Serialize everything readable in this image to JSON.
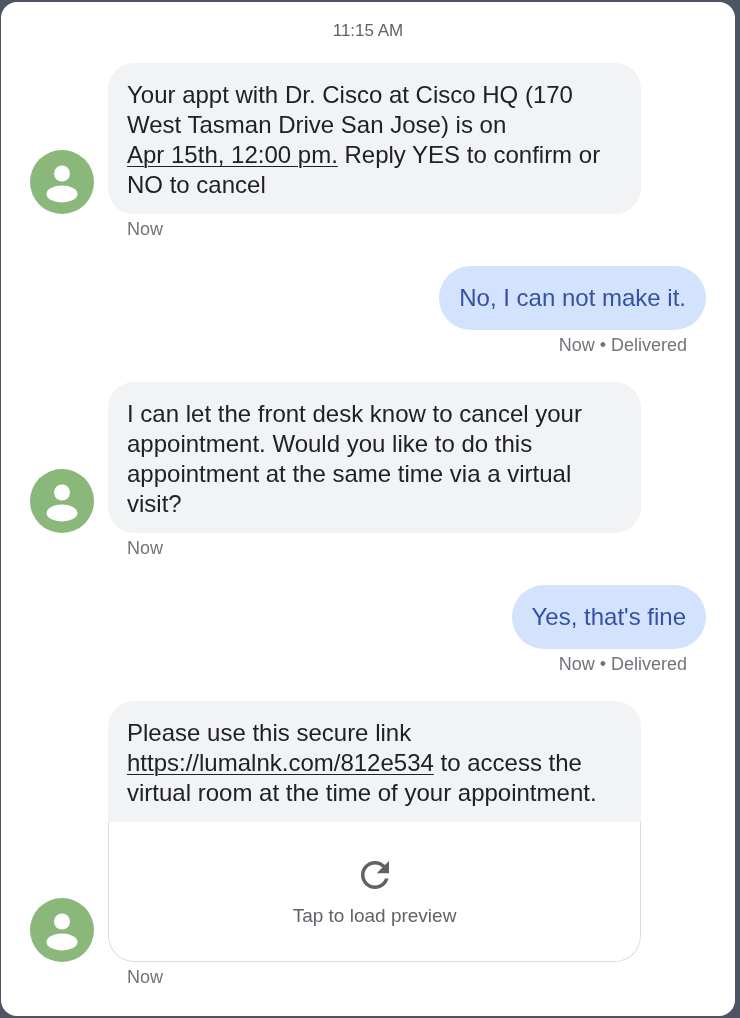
{
  "header": {
    "time": "11:15 AM"
  },
  "messages": [
    {
      "kind": "incoming",
      "parts": [
        {
          "kind": "text",
          "text": "Your appt with Dr. Cisco at Cisco HQ (170 West Tasman Drive San Jose) is on "
        },
        {
          "kind": "link",
          "text": "Apr 15th, 12:00 pm."
        },
        {
          "kind": "text",
          "text": " Reply YES to confirm or NO to cancel"
        }
      ],
      "meta": "Now"
    },
    {
      "kind": "outgoing",
      "parts": [
        {
          "kind": "text",
          "text": "No, I can not make it."
        }
      ],
      "meta": "Now • Delivered"
    },
    {
      "kind": "incoming",
      "parts": [
        {
          "kind": "text",
          "text": "I can let the front desk know to cancel your appointment. Would you like to do this appointment at the same time via a virtual visit?"
        }
      ],
      "meta": "Now"
    },
    {
      "kind": "outgoing",
      "parts": [
        {
          "kind": "text",
          "text": "Yes, that's fine"
        }
      ],
      "meta": "Now • Delivered"
    },
    {
      "kind": "incoming",
      "parts": [
        {
          "kind": "text",
          "text": "Please use this secure link "
        },
        {
          "kind": "link",
          "text": "https://lumalnk.com/812e534"
        },
        {
          "kind": "text",
          "text": " to access the virtual room at the time of your appointment."
        }
      ],
      "preview": {
        "label": "Tap to load preview"
      },
      "meta": "Now"
    }
  ]
}
